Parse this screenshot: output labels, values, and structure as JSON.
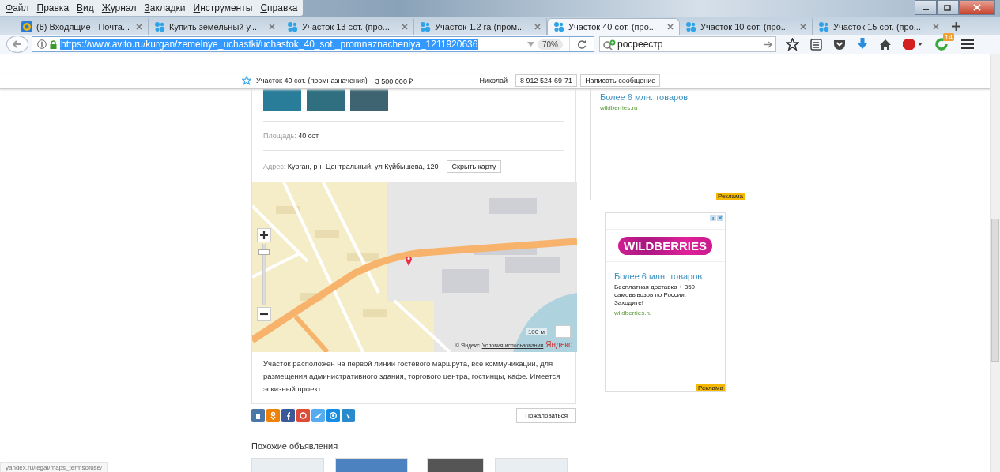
{
  "menu": [
    "Файл",
    "Правка",
    "Вид",
    "Журнал",
    "Закладки",
    "Инструменты",
    "Справка"
  ],
  "tabs": [
    {
      "title": "(8) Входящие - Почта...",
      "kind": "mail",
      "selected": false
    },
    {
      "title": "Купить земельный у...",
      "kind": "listing",
      "selected": false
    },
    {
      "title": "Участок 13 сот. (про...",
      "kind": "listing",
      "selected": false
    },
    {
      "title": "Участок 1.2 га (пром...",
      "kind": "listing",
      "selected": false
    },
    {
      "title": "Участок 40 сот. (про...",
      "kind": "listing",
      "selected": true
    },
    {
      "title": "Участок 10 сот. (про...",
      "kind": "listing",
      "selected": false
    },
    {
      "title": "Участок 15 сот. (про...",
      "kind": "listing",
      "selected": false
    }
  ],
  "navbar": {
    "url": "https://www.avito.ru/kurgan/zemelnye_uchastki/uchastok_40_sot._promnaznacheniya_1211920636",
    "zoom": "70%",
    "search": "росреестр",
    "badge": "14"
  },
  "header": {
    "title": "Участок 40 сот. (промназначения)",
    "price": "3 500 000 ₽",
    "seller": "Николай",
    "phone": "8 912 524-69-71",
    "message_button": "Написать сообщение"
  },
  "listing": {
    "area_label": "Площадь:",
    "area_value": "40 сот.",
    "address_label": "Адрес:",
    "address_value": "Курган, р-н Центральный, ул Куйбышева, 120",
    "hide_map_button": "Скрыть карту",
    "map": {
      "zoom_slider": {
        "level": 0.9
      },
      "scale": "100 м",
      "copyright": "© Яндекс",
      "terms": "Условия использования",
      "logo": "Яндекс"
    },
    "description": "Участок расположен на первой линии гостевого маршрута, все коммуникации, для размещения административного здания, торгового центра, гостинцы, кафе. Имеется эскизный проект.",
    "share": [
      {
        "color": "#4a76a8"
      },
      {
        "color": "#ee8208"
      },
      {
        "color": "#3b5998"
      },
      {
        "color": "#dd4b39"
      },
      {
        "color": "#55acee"
      },
      {
        "color": "#168de2"
      },
      {
        "color": "#2a8bcc"
      }
    ],
    "complain_button": "Пожаловаться",
    "similar_title": "Похожие объявления"
  },
  "ads": [
    {
      "kind": "text",
      "title": "Более 6 млн. товаров",
      "domain": "wildberries.ru",
      "badge": "Реклама"
    },
    {
      "kind": "banner",
      "logo": "WILDBERRIES",
      "title": "Более 6 млн. товаров",
      "text": "Бесплатная доставка + 350 самовывозов по России. Заходите!",
      "domain": "wildberries.ru",
      "badge": "Реклама"
    }
  ],
  "status_link": "yandex.ru/legal/maps_termsofuse/"
}
